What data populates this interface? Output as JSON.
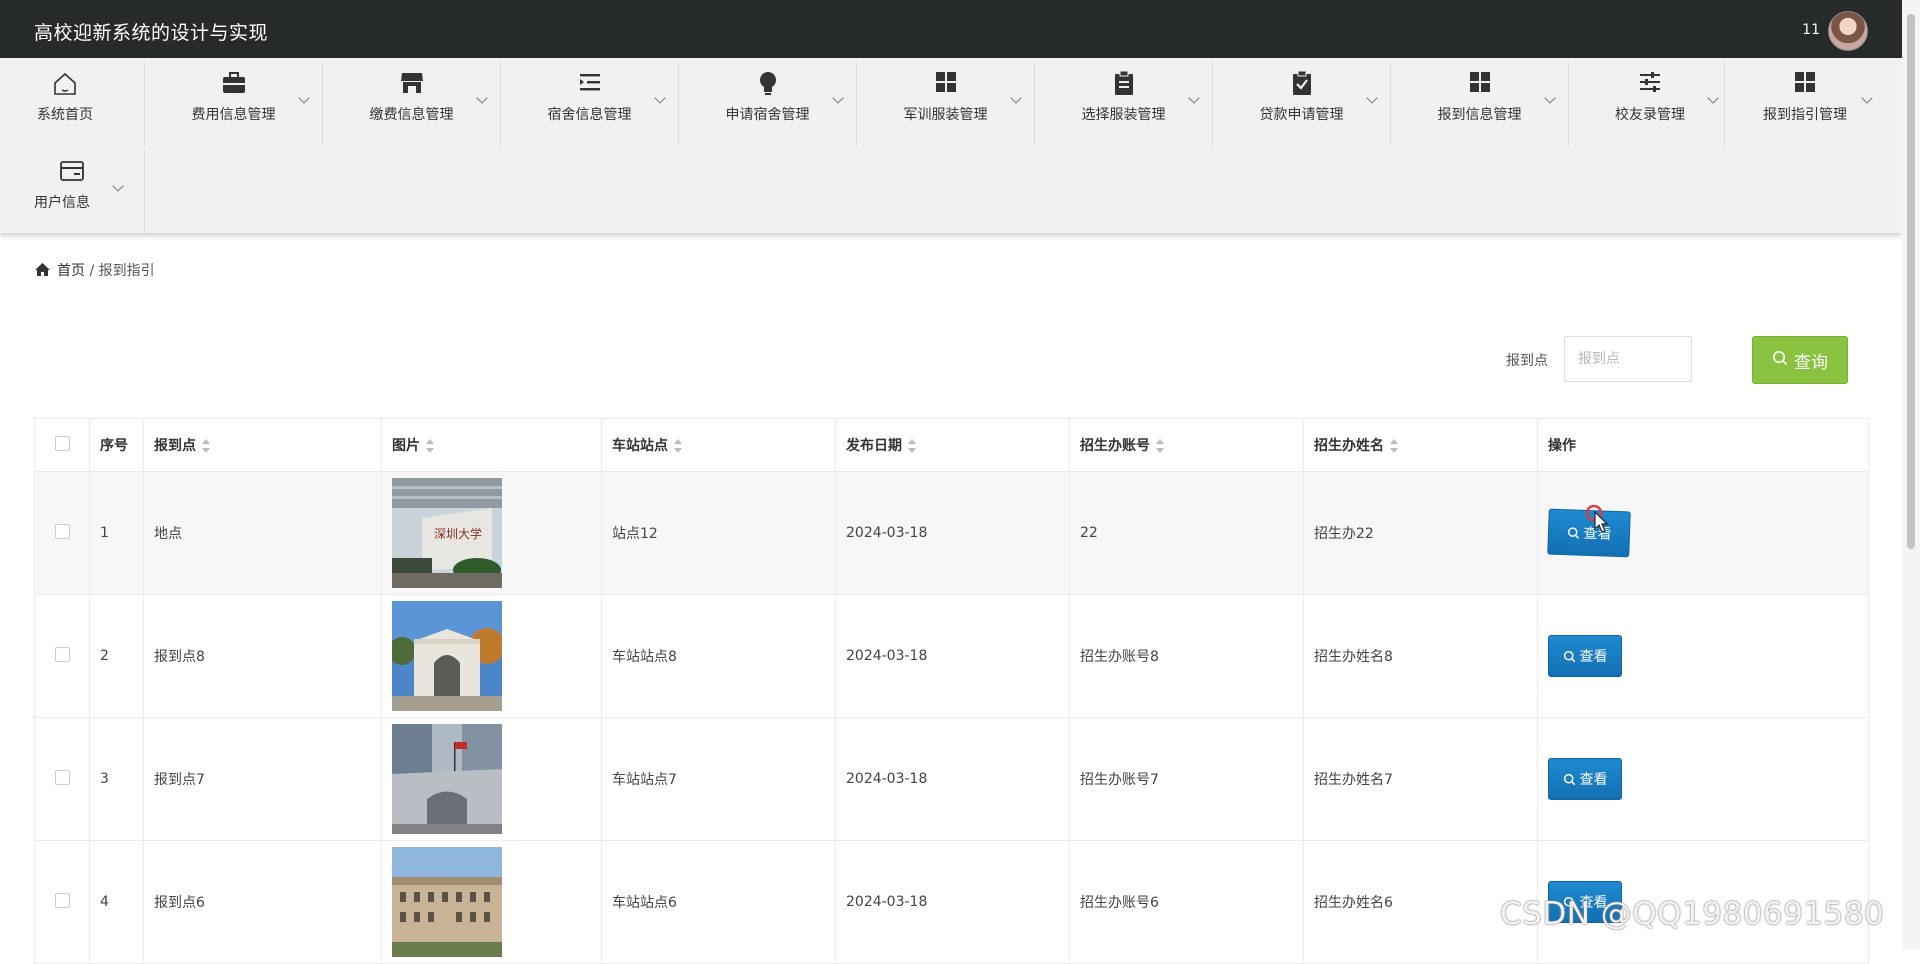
{
  "header": {
    "title": "高校迎新系统的设计与实现",
    "user": "11"
  },
  "nav": [
    {
      "label": "系统首页",
      "icon": "home-icon"
    },
    {
      "label": "费用信息管理",
      "icon": "briefcase-icon"
    },
    {
      "label": "缴费信息管理",
      "icon": "store-icon"
    },
    {
      "label": "宿舍信息管理",
      "icon": "list-indent-icon"
    },
    {
      "label": "申请宿舍管理",
      "icon": "bulb-icon"
    },
    {
      "label": "军训服装管理",
      "icon": "grid-icon"
    },
    {
      "label": "选择服装管理",
      "icon": "clipboard-icon"
    },
    {
      "label": "贷款申请管理",
      "icon": "clipboard-check-icon"
    },
    {
      "label": "报到信息管理",
      "icon": "grid-icon"
    },
    {
      "label": "校友录管理",
      "icon": "sliders-icon"
    },
    {
      "label": "报到指引管理",
      "icon": "grid-icon"
    },
    {
      "label": "用户信息",
      "icon": "card-icon"
    }
  ],
  "breadcrumb": {
    "home": "首页",
    "sep": "/",
    "current": "报到指引"
  },
  "search": {
    "label": "报到点",
    "placeholder": "报到点",
    "button": "查询"
  },
  "table": {
    "columns": [
      "序号",
      "报到点",
      "图片",
      "车站站点",
      "发布日期",
      "招生办账号",
      "招生办姓名",
      "操作"
    ],
    "rows": [
      {
        "no": "1",
        "point": "地点",
        "station": "站点12",
        "date": "2024-03-18",
        "account": "22",
        "name": "招生办22",
        "action": "查看"
      },
      {
        "no": "2",
        "point": "报到点8",
        "station": "车站站点8",
        "date": "2024-03-18",
        "account": "招生办账号8",
        "name": "招生办姓名8",
        "action": "查看"
      },
      {
        "no": "3",
        "point": "报到点7",
        "station": "车站站点7",
        "date": "2024-03-18",
        "account": "招生办账号7",
        "name": "招生办姓名7",
        "action": "查看"
      },
      {
        "no": "4",
        "point": "报到点6",
        "station": "车站站点6",
        "date": "2024-03-18",
        "account": "招生办账号6",
        "name": "招生办姓名6",
        "action": "查看"
      }
    ]
  },
  "watermark": "CSDN @QQ1980691580",
  "colors": {
    "header_bg": "#262a2b",
    "nav_bg": "#f1f1f1",
    "search_btn": "#88c23f",
    "view_btn": "#1a7fc3"
  }
}
